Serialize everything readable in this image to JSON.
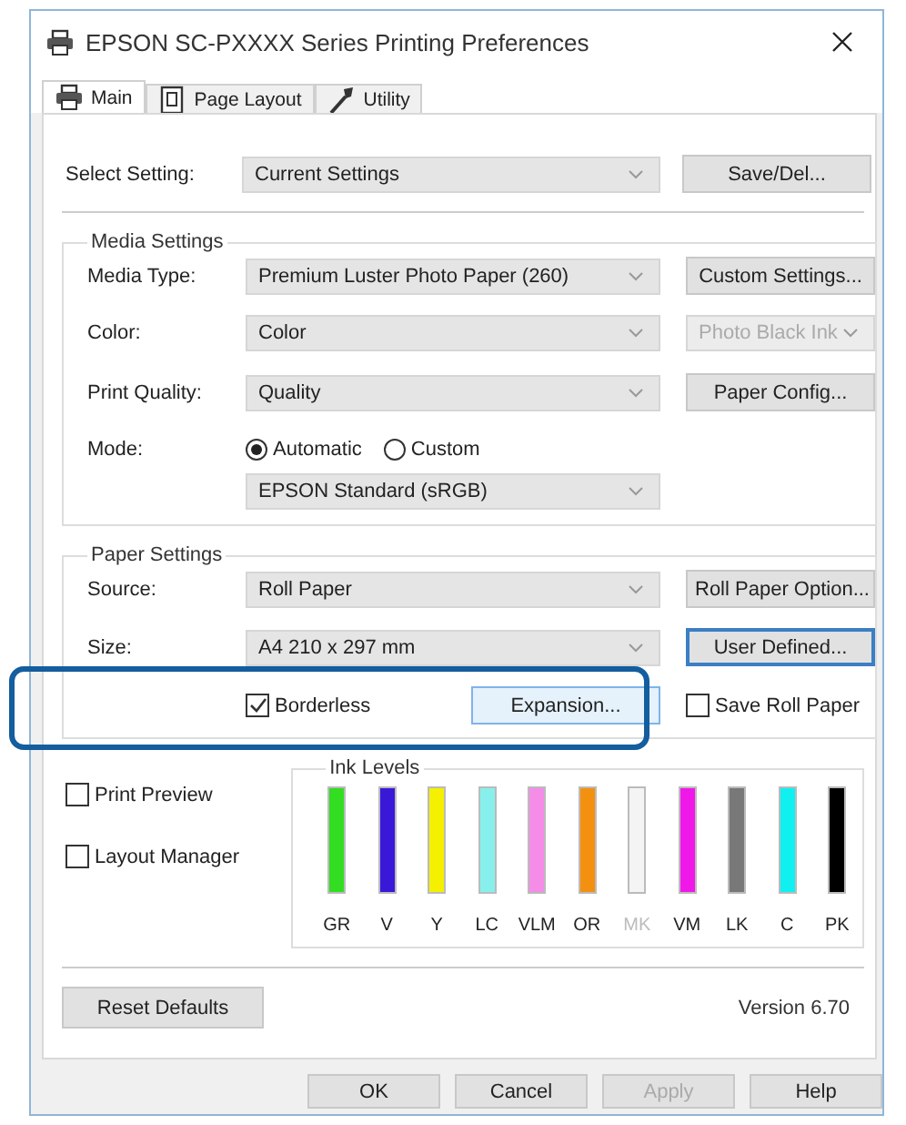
{
  "window": {
    "title": "EPSON SC-PXXXX Series Printing Preferences"
  },
  "tabs": [
    {
      "label": "Main",
      "selected": true
    },
    {
      "label": "Page Layout",
      "selected": false
    },
    {
      "label": "Utility",
      "selected": false
    }
  ],
  "select_setting": {
    "label": "Select Setting:",
    "value": "Current Settings",
    "button": "Save/Del..."
  },
  "media_settings": {
    "title": "Media Settings",
    "rows": [
      {
        "label": "Media Type:",
        "value": "Premium Luster Photo Paper (260)",
        "side": {
          "kind": "button",
          "label": "Custom Settings...",
          "disabled": false
        }
      },
      {
        "label": "Color:",
        "value": "Color",
        "side": {
          "kind": "dropdown",
          "label": "Photo Black Ink",
          "disabled": true
        }
      },
      {
        "label": "Print Quality:",
        "value": "Quality",
        "side": {
          "kind": "button",
          "label": "Paper Config...",
          "disabled": false
        }
      }
    ],
    "mode": {
      "label": "Mode:",
      "options": [
        {
          "label": "Automatic",
          "selected": true
        },
        {
          "label": "Custom",
          "selected": false
        }
      ],
      "value": "EPSON Standard (sRGB)"
    }
  },
  "paper_settings": {
    "title": "Paper Settings",
    "rows": [
      {
        "label": "Source:",
        "value": "Roll Paper",
        "button": {
          "label": "Roll Paper Option...",
          "focused": false
        }
      },
      {
        "label": "Size:",
        "value": "A4 210 x 297 mm",
        "button": {
          "label": "User Defined...",
          "focused": true
        }
      }
    ],
    "borderless": {
      "label": "Borderless",
      "checked": true
    },
    "expansion": {
      "label": "Expansion...",
      "hot": true
    },
    "save_roll_paper": {
      "label": "Save Roll Paper",
      "checked": false
    },
    "highlighted": true
  },
  "options": [
    {
      "label": "Print Preview",
      "checked": false
    },
    {
      "label": "Layout Manager",
      "checked": false
    }
  ],
  "ink_levels": {
    "title": "Ink Levels",
    "inks": [
      {
        "label": "GR",
        "color": "#33dd22",
        "level": 1,
        "disabled": false
      },
      {
        "label": "V",
        "color": "#3a18d8",
        "level": 1,
        "disabled": false
      },
      {
        "label": "Y",
        "color": "#f4f000",
        "level": 1,
        "disabled": false
      },
      {
        "label": "LC",
        "color": "#88f0ec",
        "level": 1,
        "disabled": false
      },
      {
        "label": "VLM",
        "color": "#f48ce8",
        "level": 1,
        "disabled": false
      },
      {
        "label": "OR",
        "color": "#f49010",
        "level": 1,
        "disabled": false
      },
      {
        "label": "MK",
        "color": "#f4f4f4",
        "level": 1,
        "disabled": true
      },
      {
        "label": "VM",
        "color": "#f018e8",
        "level": 1,
        "disabled": false
      },
      {
        "label": "LK",
        "color": "#787878",
        "level": 1,
        "disabled": false
      },
      {
        "label": "C",
        "color": "#10f0f0",
        "level": 1,
        "disabled": false
      },
      {
        "label": "PK",
        "color": "#000000",
        "level": 1,
        "disabled": false
      }
    ]
  },
  "reset_button": "Reset Defaults",
  "version": "Version 6.70",
  "footer_buttons": [
    {
      "label": "OK",
      "disabled": false
    },
    {
      "label": "Cancel",
      "disabled": false
    },
    {
      "label": "Apply",
      "disabled": true
    },
    {
      "label": "Help",
      "disabled": false
    }
  ]
}
